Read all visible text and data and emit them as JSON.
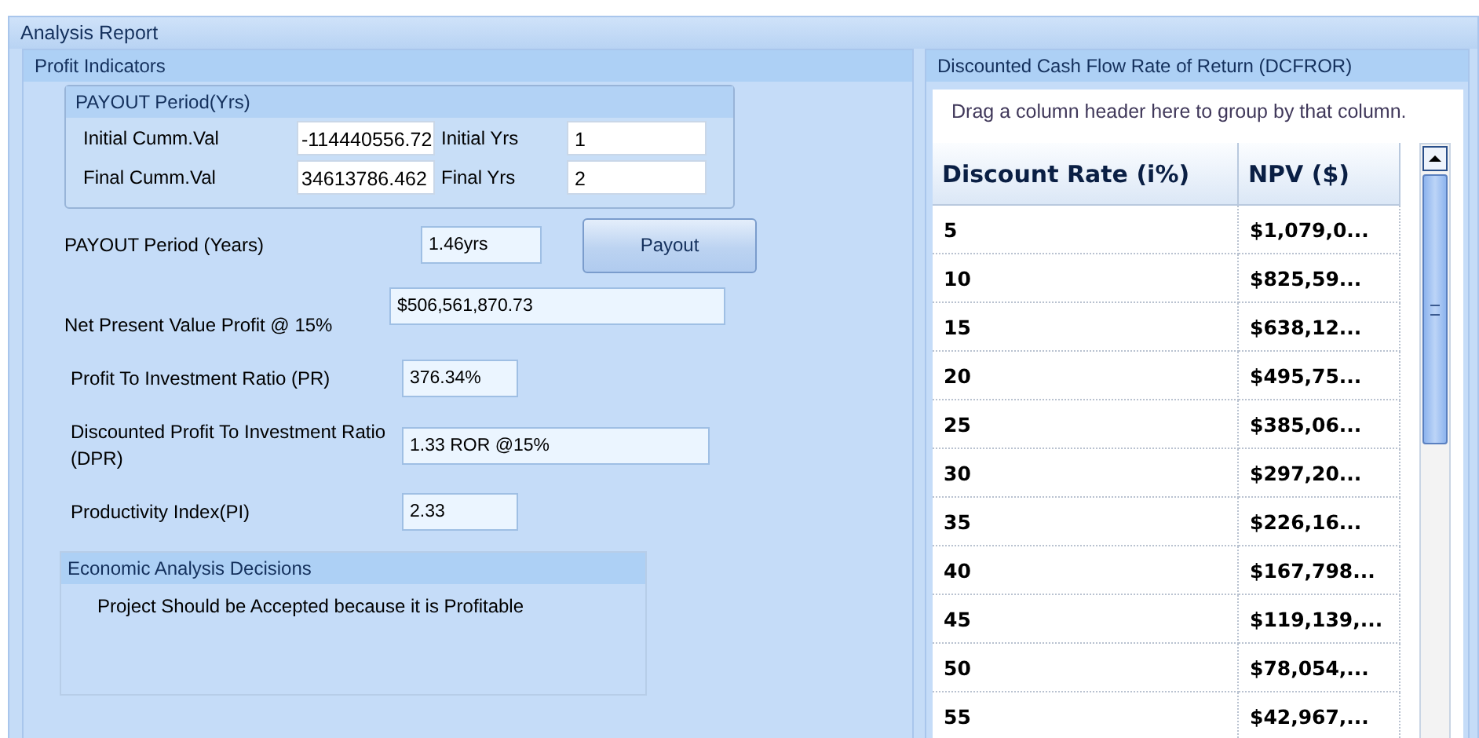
{
  "window": {
    "title": "Analysis Report"
  },
  "profit_indicators": {
    "title": "Profit Indicators",
    "payout_group": {
      "title": "PAYOUT Period(Yrs)",
      "rows": [
        {
          "label": "Initial Cumm.Val",
          "value": "-114440556.72",
          "year_label": "Initial Yrs",
          "year_value": "1"
        },
        {
          "label": "Final Cumm.Val",
          "value": "34613786.462",
          "year_label": "Final Yrs",
          "year_value": "2"
        }
      ]
    },
    "payout_period": {
      "label": "PAYOUT Period (Years)",
      "value": "1.46yrs",
      "button": "Payout"
    },
    "metrics": [
      {
        "label": "Net Present Value Profit @ 15%",
        "value": "$506,561,870.73",
        "kind": "wide"
      },
      {
        "label": "Profit To Investment Ratio (PR)",
        "value": "376.34%",
        "kind": "short"
      },
      {
        "label": "Discounted Profit To Investment Ratio (DPR)",
        "value": "1.33 ROR @15%",
        "kind": "medium"
      },
      {
        "label": "Productivity Index(PI)",
        "value": "2.33",
        "kind": "short"
      }
    ],
    "decisions": {
      "title": "Economic Analysis Decisions",
      "text": "Project Should be Accepted because it is Profitable"
    }
  },
  "dcfror": {
    "title": "Discounted Cash Flow Rate of Return (DCFROR)",
    "group_hint": "Drag a column header here to group by that column.",
    "columns": [
      "Discount Rate (i%)",
      "NPV ($)"
    ],
    "rows": [
      [
        "5",
        "$1,079,0..."
      ],
      [
        "10",
        "$825,59..."
      ],
      [
        "15",
        "$638,12..."
      ],
      [
        "20",
        "$495,75..."
      ],
      [
        "25",
        "$385,06..."
      ],
      [
        "30",
        "$297,20..."
      ],
      [
        "35",
        "$226,16..."
      ],
      [
        "40",
        "$167,798..."
      ],
      [
        "45",
        "$119,139,..."
      ],
      [
        "50",
        "$78,054,..."
      ],
      [
        "55",
        "$42,967,..."
      ]
    ]
  }
}
